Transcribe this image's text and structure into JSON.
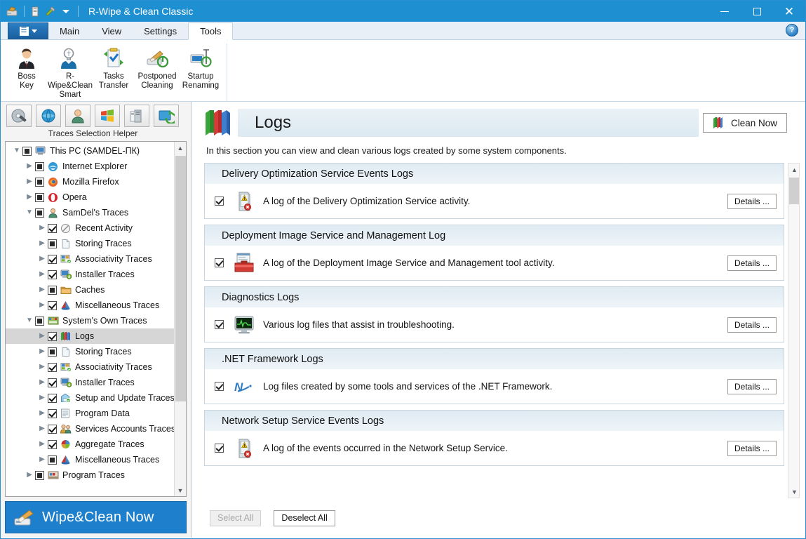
{
  "window": {
    "title": "R-Wipe & Clean Classic",
    "quick_access": [
      "app-icon",
      "document-icon",
      "tools-icon",
      "dropdown-caret"
    ],
    "controls": {
      "minimize": "minimize-icon",
      "maximize": "maximize-icon",
      "close": "close-icon"
    }
  },
  "ribbon": {
    "app_menu_label": "app-menu",
    "tabs": [
      {
        "label": "Main",
        "active": false
      },
      {
        "label": "View",
        "active": false
      },
      {
        "label": "Settings",
        "active": false
      },
      {
        "label": "Tools",
        "active": true
      }
    ],
    "help_label": "?",
    "items": [
      {
        "label": "Boss\nKey",
        "icon": "boss-key-icon"
      },
      {
        "label": "R-Wipe&Clean\nSmart",
        "icon": "smart-bulb-icon"
      },
      {
        "label": "Tasks\nTransfer",
        "icon": "tasks-transfer-icon"
      },
      {
        "label": "Postponed\nCleaning",
        "icon": "postponed-cleaning-icon"
      },
      {
        "label": "Startup\nRenaming",
        "icon": "startup-renaming-icon"
      }
    ]
  },
  "sidebar": {
    "helper_caption": "Traces Selection Helper",
    "helper_buttons": [
      "disc-wipe-icon",
      "globe-icon",
      "user-icon",
      "windows-icon",
      "server-icon",
      "refresh-icon"
    ],
    "wipe_button_label": "Wipe&Clean Now",
    "tree": [
      {
        "label": "This PC  (SAMDEL-ПК)",
        "indent": 0,
        "expander": "down",
        "check": "partial",
        "icon": "computer-icon",
        "selected": false
      },
      {
        "label": "Internet  Explorer",
        "indent": 1,
        "expander": "right",
        "check": "partial",
        "icon": "ie-icon",
        "selected": false
      },
      {
        "label": "Mozilla  Firefox",
        "indent": 1,
        "expander": "right",
        "check": "partial",
        "icon": "firefox-icon",
        "selected": false
      },
      {
        "label": "Opera",
        "indent": 1,
        "expander": "right",
        "check": "partial",
        "icon": "opera-icon",
        "selected": false
      },
      {
        "label": "SamDel's Traces",
        "indent": 1,
        "expander": "down",
        "check": "partial",
        "icon": "user-traces-icon",
        "selected": false
      },
      {
        "label": "Recent Activity",
        "indent": 2,
        "expander": "right",
        "check": "checked",
        "icon": "recent-activity-icon",
        "selected": false
      },
      {
        "label": "Storing Traces",
        "indent": 2,
        "expander": "right",
        "check": "partial",
        "icon": "storing-traces-icon",
        "selected": false
      },
      {
        "label": "Associativity Traces",
        "indent": 2,
        "expander": "right",
        "check": "checked",
        "icon": "associativity-icon",
        "selected": false
      },
      {
        "label": "Installer Traces",
        "indent": 2,
        "expander": "right",
        "check": "checked",
        "icon": "installer-icon",
        "selected": false
      },
      {
        "label": "Caches",
        "indent": 2,
        "expander": "right",
        "check": "partial",
        "icon": "caches-icon",
        "selected": false
      },
      {
        "label": "Miscellaneous Traces",
        "indent": 2,
        "expander": "right",
        "check": "checked",
        "icon": "misc-icon",
        "selected": false
      },
      {
        "label": "System's Own Traces",
        "indent": 1,
        "expander": "down",
        "check": "partial",
        "icon": "system-traces-icon",
        "selected": false
      },
      {
        "label": "Logs",
        "indent": 2,
        "expander": "right",
        "check": "checked",
        "icon": "logs-icon",
        "selected": true
      },
      {
        "label": "Storing Traces",
        "indent": 2,
        "expander": "right",
        "check": "partial",
        "icon": "storing-traces-icon",
        "selected": false
      },
      {
        "label": "Associativity Traces",
        "indent": 2,
        "expander": "right",
        "check": "checked",
        "icon": "associativity-icon",
        "selected": false
      },
      {
        "label": "Installer Traces",
        "indent": 2,
        "expander": "right",
        "check": "checked",
        "icon": "installer-icon",
        "selected": false
      },
      {
        "label": "Setup and Update Traces",
        "indent": 2,
        "expander": "right",
        "check": "checked",
        "icon": "setup-update-icon",
        "selected": false
      },
      {
        "label": "Program Data",
        "indent": 2,
        "expander": "right",
        "check": "checked",
        "icon": "program-data-icon",
        "selected": false
      },
      {
        "label": "Services Accounts Traces",
        "indent": 2,
        "expander": "right",
        "check": "checked",
        "icon": "services-accounts-icon",
        "selected": false
      },
      {
        "label": "Aggregate Traces",
        "indent": 2,
        "expander": "right",
        "check": "checked",
        "icon": "aggregate-icon",
        "selected": false
      },
      {
        "label": "Miscellaneous Traces",
        "indent": 2,
        "expander": "right",
        "check": "partial",
        "icon": "misc-icon",
        "selected": false
      },
      {
        "label": "Program Traces",
        "indent": 1,
        "expander": "right",
        "check": "partial",
        "icon": "program-traces-icon",
        "selected": false
      }
    ]
  },
  "main": {
    "page_title": "Logs",
    "page_icon": "logs-icon",
    "description": "In this section you can view and clean various logs created by some system components.",
    "clean_now_label": "Clean Now",
    "details_label": "Details ...",
    "panels": [
      {
        "title": "Delivery Optimization Service Events Logs",
        "description": "A log of the Delivery Optimization Service activity.",
        "checked": true,
        "icon": "event-log-error-icon"
      },
      {
        "title": "Deployment Image Service and Management Log",
        "description": "A log of the Deployment Image Service and Management tool activity.",
        "checked": true,
        "icon": "toolbox-icon"
      },
      {
        "title": "Diagnostics Logs",
        "description": "Various log files that assist in troubleshooting.",
        "checked": true,
        "icon": "diagnostics-monitor-icon"
      },
      {
        "title": ".NET Framework Logs",
        "description": "Log files created by some tools and services of the .NET Framework.",
        "checked": true,
        "icon": "dotnet-icon"
      },
      {
        "title": "Network Setup Service Events Logs",
        "description": "A log of the events occurred in the Network Setup Service.",
        "checked": true,
        "icon": "event-log-error-icon"
      }
    ],
    "select_all_label": "Select All",
    "deselect_all_label": "Deselect All"
  },
  "colors": {
    "titlebar": "#1e90d2",
    "accent": "#1e80cd",
    "panel_head": "#dfeaf2",
    "selection": "#d6d6d6"
  }
}
